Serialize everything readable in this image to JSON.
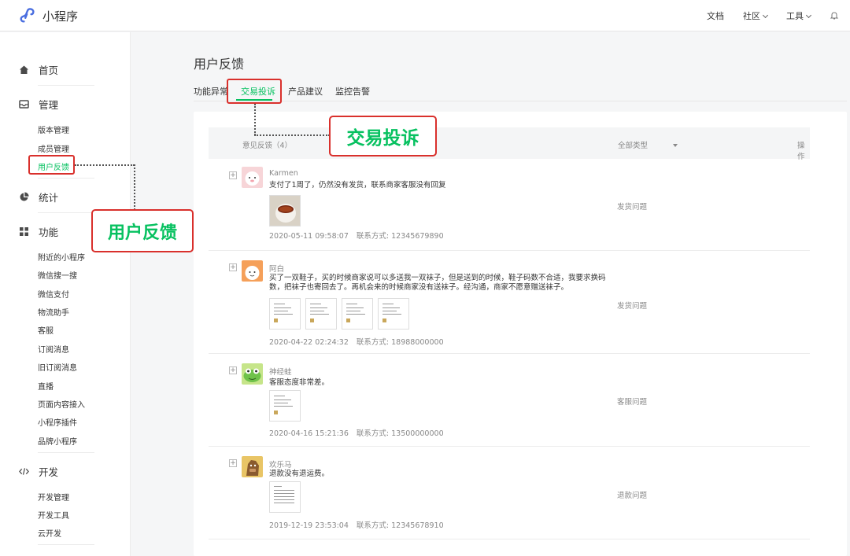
{
  "app": {
    "name": "小程序"
  },
  "topnav": {
    "docs": "文档",
    "community": "社区",
    "tools": "工具"
  },
  "sidebar": {
    "home": "首页",
    "manage": {
      "label": "管理",
      "items": [
        "版本管理",
        "成员管理",
        "用户反馈"
      ]
    },
    "stats": "统计",
    "features": {
      "label": "功能",
      "items": [
        "附近的小程序",
        "微信搜一搜",
        "微信支付",
        "物流助手",
        "客服",
        "订阅消息",
        "旧订阅消息",
        "直播",
        "页面内容接入",
        "小程序插件",
        "品牌小程序"
      ]
    },
    "dev": {
      "label": "开发",
      "items": [
        "开发管理",
        "开发工具",
        "云开发"
      ]
    }
  },
  "page": {
    "title": "用户反馈",
    "tabs": [
      "功能异常",
      "交易投诉",
      "产品建议",
      "监控告警"
    ]
  },
  "table": {
    "col_feedback": "意见反馈（4）",
    "col_type": "全部类型",
    "col_action": "操作",
    "rows": [
      {
        "user": "Karmen",
        "text": "支付了1周了，仍然没有发货，联系商家客服没有回复",
        "time": "2020-05-11 09:58:07",
        "contact": "联系方式: 12345679890",
        "type": "发货问题"
      },
      {
        "user": "阿白",
        "text": "买了一双鞋子，买的时候商家说可以多送我一双袜子，但是送到的时候，鞋子码数不合适，我要求换码数，把袜子也寄回去了。再机会来的时候商家没有送袜子。经沟通，商家不愿意赠送袜子。",
        "time": "2020-04-22 02:24:32",
        "contact": "联系方式: 18988000000",
        "type": "发货问题"
      },
      {
        "user": "神经蛙",
        "text": "客服态度非常差。",
        "time": "2020-04-16 15:21:36",
        "contact": "联系方式: 13500000000",
        "type": "客服问题"
      },
      {
        "user": "欢乐马",
        "text": "退款没有退运费。",
        "time": "2019-12-19 23:53:04",
        "contact": "联系方式: 12345678910",
        "type": "退款问题"
      }
    ]
  },
  "callouts": {
    "tab": "交易投诉",
    "menu": "用户反馈"
  },
  "colors": {
    "accent": "#07c160",
    "highlight": "#d9302c"
  }
}
